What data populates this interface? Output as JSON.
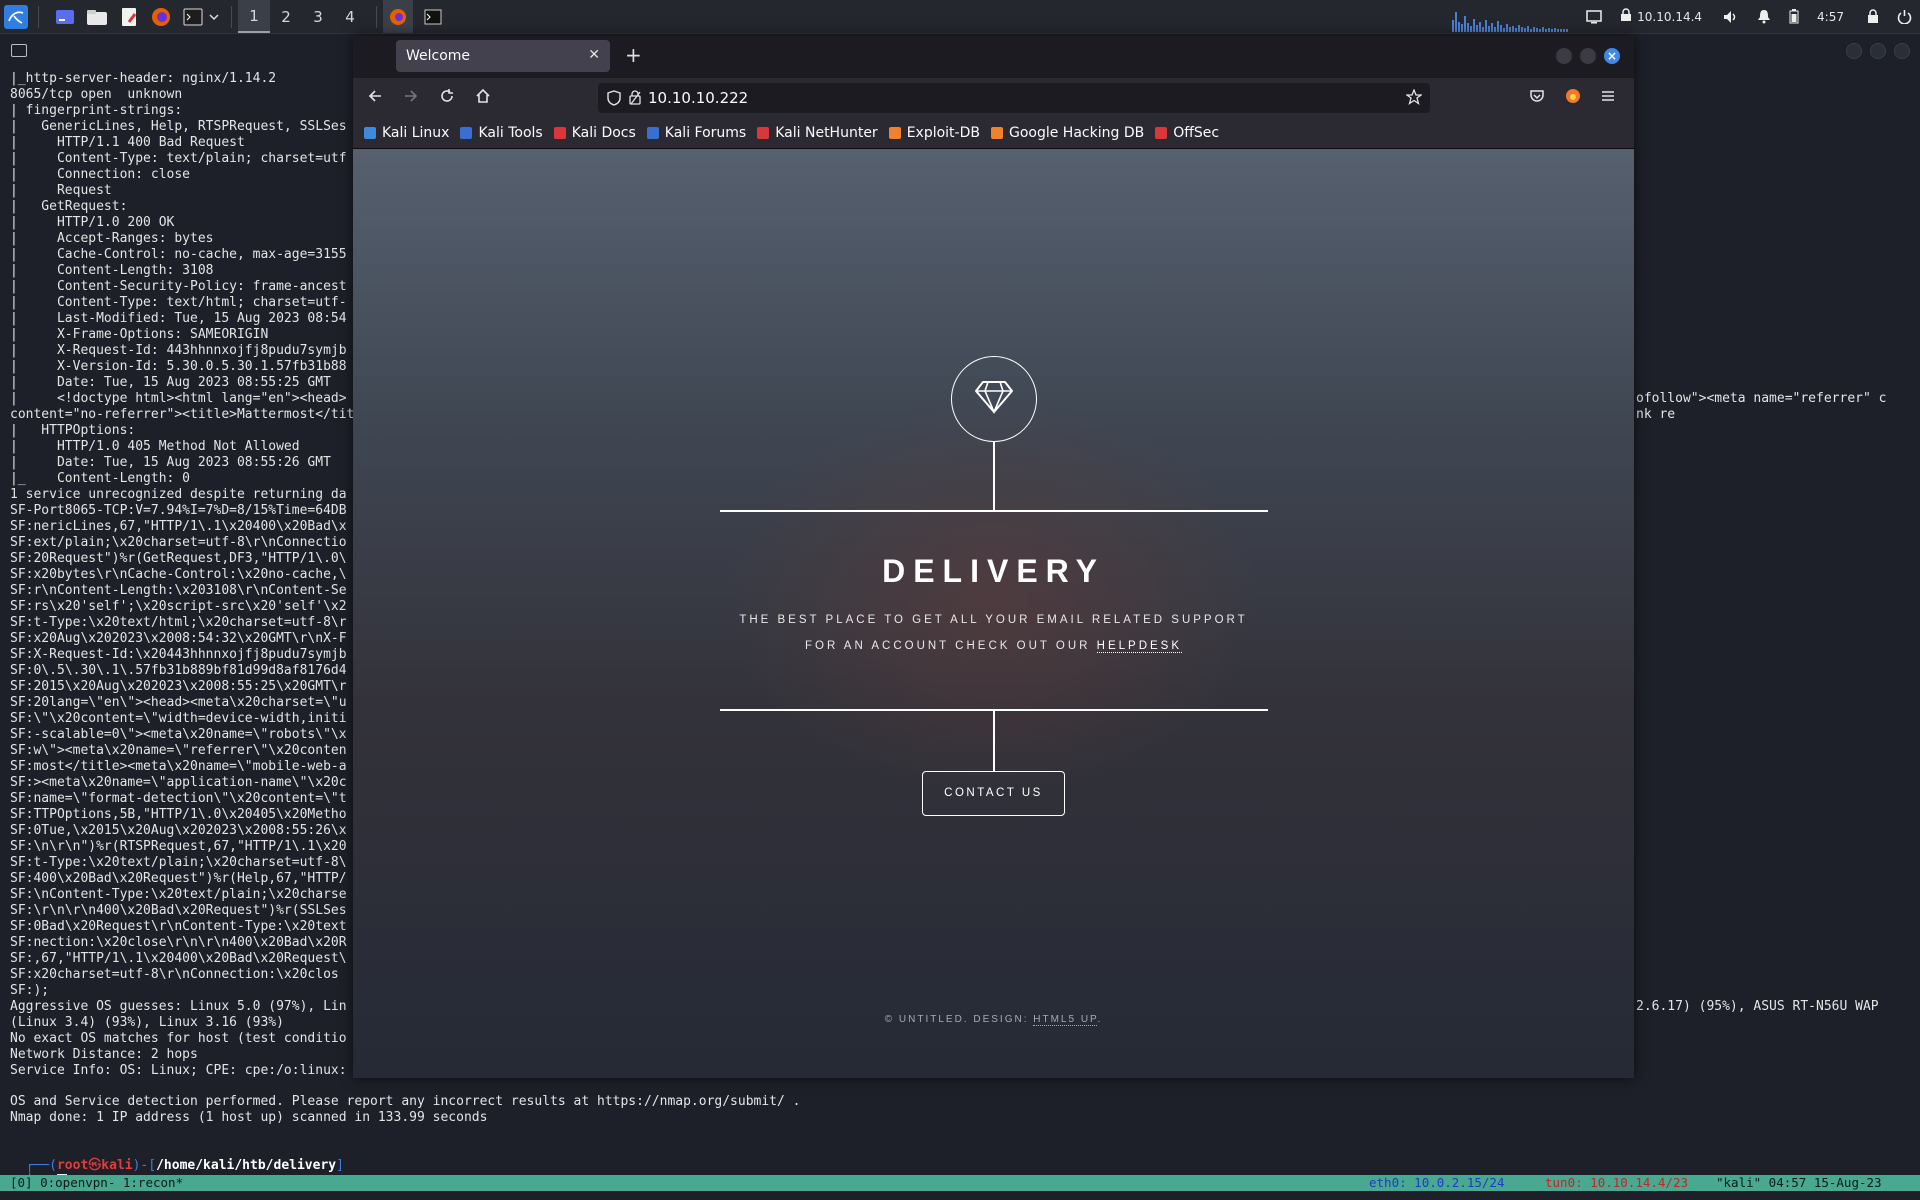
{
  "taskbar": {
    "workspaces": [
      "1",
      "2",
      "3",
      "4"
    ],
    "tray": {
      "ip": "10.10.14.4",
      "time": "4:57"
    }
  },
  "terminal": {
    "lines": [
      "|_http-server-header: nginx/1.14.2",
      "8065/tcp open  unknown",
      "| fingerprint-strings:",
      "|   GenericLines, Help, RTSPRequest, SSLSes",
      "|     HTTP/1.1 400 Bad Request",
      "|     Content-Type: text/plain; charset=utf",
      "|     Connection: close",
      "|     Request",
      "|   GetRequest:",
      "|     HTTP/1.0 200 OK",
      "|     Accept-Ranges: bytes",
      "|     Cache-Control: no-cache, max-age=3155",
      "|     Content-Length: 3108",
      "|     Content-Security-Policy: frame-ancest",
      "|     Content-Type: text/html; charset=utf-",
      "|     Last-Modified: Tue, 15 Aug 2023 08:54",
      "|     X-Frame-Options: SAMEORIGIN",
      "|     X-Request-Id: 443hhnnxojfj8pudu7symjb",
      "|     X-Version-Id: 5.30.0.5.30.1.57fb31b88",
      "|     Date: Tue, 15 Aug 2023 08:55:25 GMT",
      "|     <!doctype html><html lang=\"en\"><head>",
      "content=\"no-referrer\"><title>Mattermost</tit",
      "|   HTTPOptions:",
      "|     HTTP/1.0 405 Method Not Allowed",
      "|     Date: Tue, 15 Aug 2023 08:55:26 GMT",
      "|_    Content-Length: 0",
      "1 service unrecognized despite returning da",
      "SF-Port8065-TCP:V=7.94%I=7%D=8/15%Time=64DB",
      "SF:nericLines,67,\"HTTP/1\\.1\\x20400\\x20Bad\\x",
      "SF:ext/plain;\\x20charset=utf-8\\r\\nConnectio",
      "SF:20Request\")%r(GetRequest,DF3,\"HTTP/1\\.0\\",
      "SF:x20bytes\\r\\nCache-Control:\\x20no-cache,\\",
      "SF:r\\nContent-Length:\\x203108\\r\\nContent-Se",
      "SF:rs\\x20'self';\\x20script-src\\x20'self'\\x2",
      "SF:t-Type:\\x20text/html;\\x20charset=utf-8\\r",
      "SF:x20Aug\\x202023\\x2008:54:32\\x20GMT\\r\\nX-F",
      "SF:X-Request-Id:\\x20443hhnnxojfj8pudu7symjb",
      "SF:0\\.5\\.30\\.1\\.57fb31b889bf81d99d8af8176d4",
      "SF:2015\\x20Aug\\x202023\\x2008:55:25\\x20GMT\\r",
      "SF:20lang=\\\"en\\\"><head><meta\\x20charset=\\\"u",
      "SF:\\\"\\x20content=\\\"width=device-width,initi",
      "SF:-scalable=0\\\"><meta\\x20name=\\\"robots\\\"\\x",
      "SF:w\\\"><meta\\x20name=\\\"referrer\\\"\\x20conten",
      "SF:most</title><meta\\x20name=\\\"mobile-web-a",
      "SF:><meta\\x20name=\\\"application-name\\\"\\x20c",
      "SF:name=\\\"format-detection\\\"\\x20content=\\\"t",
      "SF:TTPOptions,5B,\"HTTP/1\\.0\\x20405\\x20Metho",
      "SF:0Tue,\\x2015\\x20Aug\\x202023\\x2008:55:26\\x",
      "SF:\\n\\r\\n\")%r(RTSPRequest,67,\"HTTP/1\\.1\\x20",
      "SF:t-Type:\\x20text/plain;\\x20charset=utf-8\\",
      "SF:400\\x20Bad\\x20Request\")%r(Help,67,\"HTTP/",
      "SF:\\nContent-Type:\\x20text/plain;\\x20charse",
      "SF:\\r\\n\\r\\n400\\x20Bad\\x20Request\")%r(SSLSes",
      "SF:0Bad\\x20Request\\r\\nContent-Type:\\x20text",
      "SF:nection:\\x20close\\r\\n\\r\\n400\\x20Bad\\x20R",
      "SF:,67,\"HTTP/1\\.1\\x20400\\x20Bad\\x20Request\\",
      "SF:x20charset=utf-8\\r\\nConnection:\\x20clos",
      "SF:);",
      "Aggressive OS guesses: Linux 5.0 (97%), Lin",
      "(Linux 3.4) (93%), Linux 3.16 (93%)",
      "No exact OS matches for host (test conditio",
      "Network Distance: 2 hops",
      "Service Info: OS: Linux; CPE: cpe:/o:linux:"
    ],
    "right_fragments": [
      "ofollow\"><meta name=\"referrer\" c",
      "nk re",
      "2.6.17) (95%), ASUS RT-N56U WAP"
    ],
    "bottom_lines": [
      "OS and Service detection performed. Please report any incorrect results at https://nmap.org/submit/ .",
      "Nmap done: 1 IP address (1 host up) scanned in 133.99 seconds"
    ],
    "prompt": {
      "user": "root",
      "host": "kali",
      "path": "/home/kali/htb/delivery"
    }
  },
  "statusbar": {
    "left": "[0] 0:openvpn- 1:recon*",
    "eth0_label": "eth0:",
    "eth0": "10.0.2.15/24",
    "tun0_label": "tun0:",
    "tun0": "10.10.14.4/23",
    "right": "\"kali\" 04:57 15-Aug-23"
  },
  "browser": {
    "tab_title": "Welcome",
    "url": "10.10.10.222",
    "bookmarks": [
      {
        "label": "Kali Linux",
        "color": "#3f8ad9"
      },
      {
        "label": "Kali Tools",
        "color": "#3b6fcf"
      },
      {
        "label": "Kali Docs",
        "color": "#d9373a"
      },
      {
        "label": "Kali Forums",
        "color": "#3b6fcf"
      },
      {
        "label": "Kali NetHunter",
        "color": "#d9373a"
      },
      {
        "label": "Exploit-DB",
        "color": "#f0812d"
      },
      {
        "label": "Google Hacking DB",
        "color": "#f0812d"
      },
      {
        "label": "OffSec",
        "color": "#d9373a"
      }
    ]
  },
  "site": {
    "title": "DELIVERY",
    "tagline_1": "THE BEST PLACE TO GET ALL YOUR EMAIL RELATED SUPPORT",
    "tagline_2_prefix": "FOR AN ACCOUNT CHECK OUT OUR ",
    "helpdesk_label": "HELPDESK",
    "contact_label": "CONTACT US",
    "footer_prefix": "© UNTITLED. DESIGN: ",
    "footer_link": "HTML5 UP",
    "footer_suffix": "."
  }
}
